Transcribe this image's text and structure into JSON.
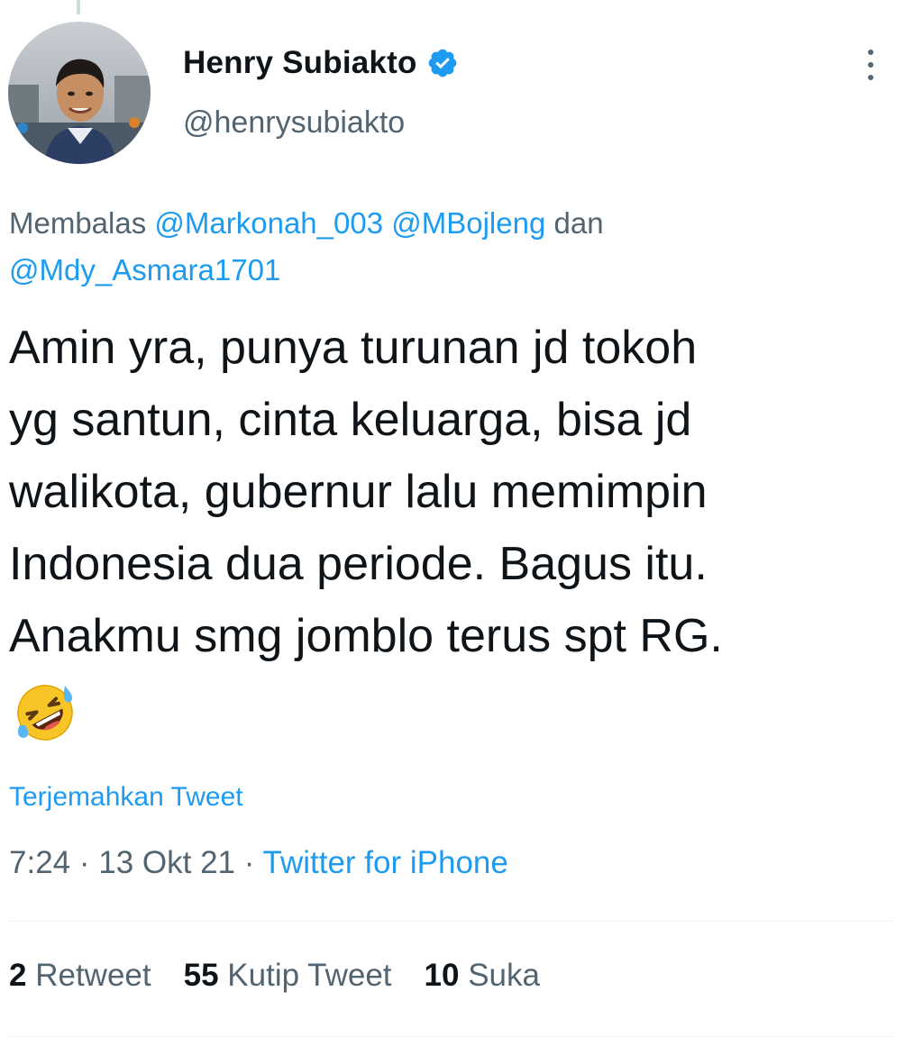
{
  "author": {
    "display_name": "Henry Subiakto",
    "handle": "@henrysubiakto",
    "verified": true
  },
  "reply_to": {
    "prefix": "Membalas",
    "mention_1": "@Markonah_003",
    "mention_2": "@MBojleng",
    "conjunction": "dan",
    "mention_3": "@Mdy_Asmara1701"
  },
  "tweet": {
    "lines": [
      "Amin yra, punya turunan jd tokoh",
      "yg santun, cinta keluarga, bisa jd",
      "walikota, gubernur lalu memimpin",
      "Indonesia dua periode. Bagus itu.",
      "Anakmu smg jomblo terus spt RG."
    ],
    "emoji": "rolling-on-floor-laughing"
  },
  "translate_label": "Terjemahkan Tweet",
  "meta": {
    "time": "7:24",
    "separator": "·",
    "date": "13 Okt 21",
    "source": "Twitter for iPhone"
  },
  "stats": {
    "retweets_count": "2",
    "retweets_label": "Retweet",
    "quotes_count": "55",
    "quotes_label": "Kutip Tweet",
    "likes_count": "10",
    "likes_label": "Suka"
  },
  "colors": {
    "link_blue": "#1d9bf0",
    "secondary_text": "#536471",
    "primary_text": "#0f1419",
    "divider": "#eff3f4"
  }
}
